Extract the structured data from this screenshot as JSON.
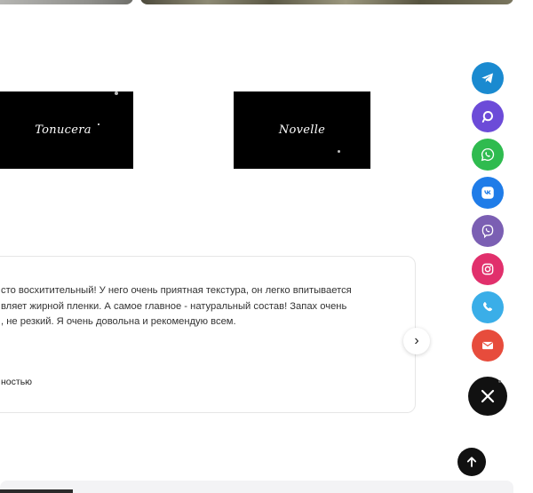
{
  "brands": [
    {
      "name": "Tonucera"
    },
    {
      "name": "Novelle"
    }
  ],
  "review": {
    "text": "сто восхитительный! У него очень приятная текстура, он легко впитывается\nвляет жирной пленки. А самое главное - натуральный состав! Запах очень\n, не резкий. Я очень довольна и рекомендую всем.",
    "author_suffix": "ностью",
    "next_glyph": "›"
  },
  "contact_buttons": [
    {
      "name": "telegram",
      "color": "#1a8ad0",
      "icon": "telegram-icon"
    },
    {
      "name": "max-messenger",
      "color": "#6c4bd8",
      "icon": "max-messenger-icon"
    },
    {
      "name": "whatsapp",
      "color": "#2fbb4f",
      "icon": "whatsapp-icon"
    },
    {
      "name": "vk",
      "color": "#1f7ce8",
      "icon": "vk-icon"
    },
    {
      "name": "viber",
      "color": "#7b5fb3",
      "icon": "viber-icon"
    },
    {
      "name": "instagram",
      "color": "#e1306c",
      "icon": "instagram-icon"
    },
    {
      "name": "phone",
      "color": "#3aaee8",
      "icon": "phone-icon"
    },
    {
      "name": "email",
      "color": "#e74c3c",
      "icon": "email-icon"
    }
  ],
  "fab": {
    "close_icon": "close-icon",
    "up_icon": "arrow-up-icon",
    "color": "#111111"
  }
}
